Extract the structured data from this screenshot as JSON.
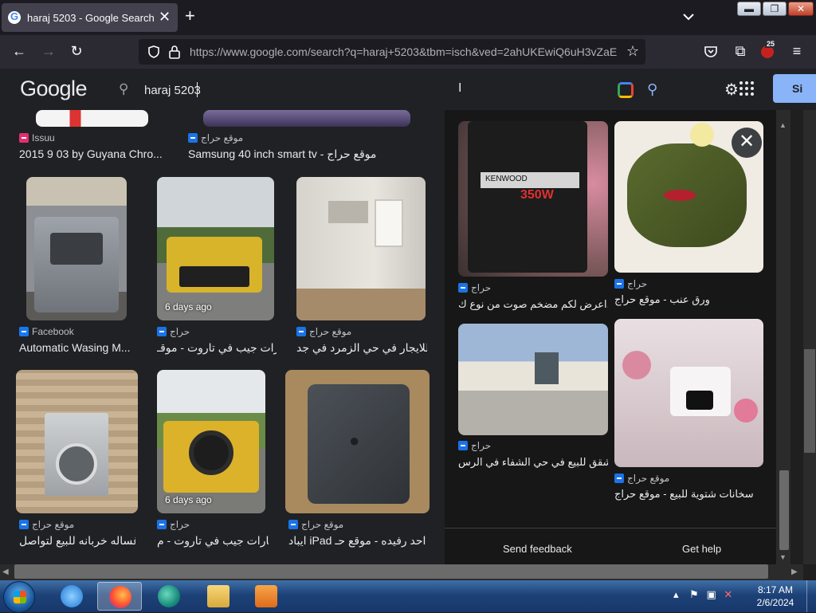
{
  "browser": {
    "tab_title": "haraj 5203 - Google Search",
    "url": "https://www.google.com/search?q=haraj+5203&tbm=isch&ved=2ahUKEwiQ6uH3vZaE",
    "url_host": "google.com",
    "extension_badge": "25"
  },
  "google": {
    "logo": "Google",
    "query": "haraj 5203",
    "signin_label": "Si"
  },
  "results": [
    {
      "source": "Issuu",
      "caption": "2015 9 03 by Guyana Chro...",
      "days": ""
    },
    {
      "source": "موقع حراج",
      "caption": "Samsung 40 inch smart tv - موقع حراج",
      "days": ""
    },
    {
      "source": "Facebook",
      "caption": "Automatic Wasing M...",
      "days": ""
    },
    {
      "source": "حراج",
      "caption": "سيارات جيب في تاروت - موقـ...",
      "days": "6 days ago"
    },
    {
      "source": "موقع حراج",
      "caption": "فل للايجار في حي الزمرد في جد...",
      "days": ""
    },
    {
      "source": "موقع حراج",
      "caption": "غساله خربانه للبيع لتواصل - ...",
      "days": ""
    },
    {
      "source": "حراج",
      "caption": "سيارات جيب في تاروت - م...",
      "days": "6 days ago"
    },
    {
      "source": "موقع حراج",
      "caption": "ايباد iPad في احد رفيده - موقع حـ...",
      "days": ""
    }
  ],
  "panel": {
    "items": [
      {
        "source": "حراج",
        "caption": "اعرض لكم مضخم صوت من نوع ك..."
      },
      {
        "source": "حراج",
        "caption": "ورق عنب - موقع حراج"
      },
      {
        "source": "حراج",
        "caption": "شقق للبيع في حي الشفاء في الرس - ..."
      },
      {
        "source": "موقع حراج",
        "caption": "سخانات شتوية للبيع - موقع حراج"
      }
    ],
    "amp_brand": "KENWOOD",
    "amp_watts": "350W",
    "feedback": "Send feedback",
    "help": "Get help"
  },
  "taskbar": {
    "time": "8:17 AM",
    "date": "2/6/2024"
  },
  "colors": {
    "accent": "#8ab4f8",
    "page_bg": "#202124",
    "panel_bg": "#171717"
  }
}
